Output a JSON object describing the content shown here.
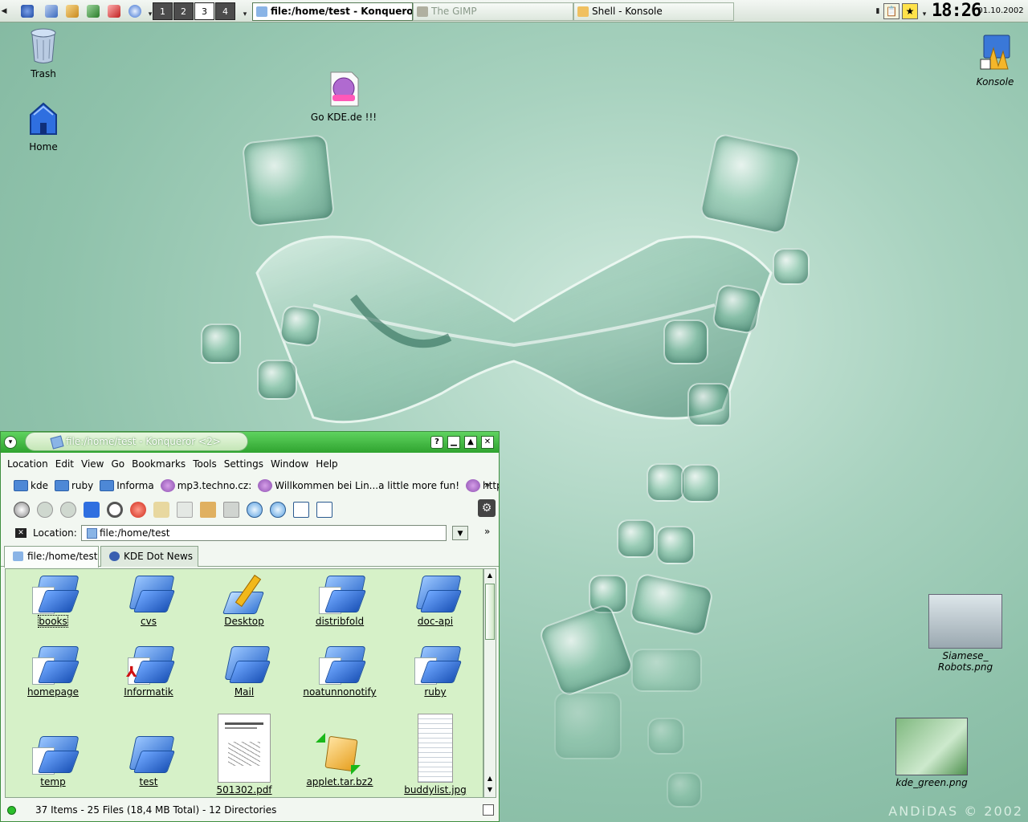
{
  "panel": {
    "pager": [
      "1",
      "2",
      "3",
      "4"
    ],
    "active_desktop": "3",
    "tasks": [
      {
        "label": "file:/home/test - Konqueror <2>",
        "state": "active"
      },
      {
        "label": "The GIMP",
        "state": "dim"
      },
      {
        "label": "Shell - Konsole",
        "state": "normal"
      }
    ],
    "clock": "18:26",
    "date": "01.10.2002"
  },
  "desktop": {
    "trash": "Trash",
    "home": "Home",
    "gokde": "Go KDE.de !!!",
    "konsole": "Konsole",
    "siamese": "Siamese_ Robots.png",
    "kdegreen": "kde_green.png",
    "watermark": "ANDiDAS © 2002"
  },
  "konqueror": {
    "title": "file:/home/test - Konqueror <2>",
    "menu": [
      "Location",
      "Edit",
      "View",
      "Go",
      "Bookmarks",
      "Tools",
      "Settings",
      "Window",
      "Help"
    ],
    "bookmarks": [
      "kde",
      "ruby",
      "Informa",
      "mp3.techno.cz:",
      "Willkommen bei Lin...a little more fun!",
      "http:;"
    ],
    "location_label": "Location:",
    "location_value": "file:/home/test",
    "tabs": [
      "file:/home/test",
      "KDE Dot News"
    ],
    "files": [
      "books",
      "cvs",
      "Desktop",
      "distribfold",
      "doc-api",
      "homepage",
      "Informatik",
      "Mail",
      "noatunnonotify",
      "ruby",
      "temp",
      "test",
      "501302.pdf",
      "applet.tar.bz2",
      "buddylist.jpg"
    ],
    "status": "37 Items - 25 Files (18,4 MB Total) - 12 Directories"
  },
  "colors": {
    "accent": "#2fa32f",
    "view_bg": "#d6f1c8",
    "folder_blue": "#2361c7"
  }
}
